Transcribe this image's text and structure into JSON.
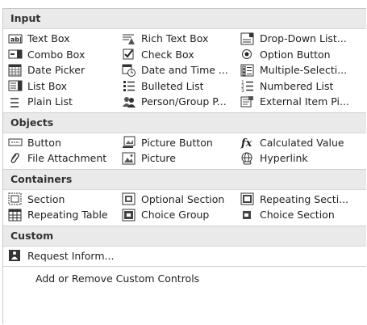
{
  "sections": {
    "input": {
      "title": "Input",
      "items": [
        {
          "label": "Text Box",
          "icon": "text-box-icon"
        },
        {
          "label": "Rich Text Box",
          "icon": "rich-text-box-icon"
        },
        {
          "label": "Drop-Down List...",
          "icon": "drop-down-list-icon"
        },
        {
          "label": "Combo Box",
          "icon": "combo-box-icon"
        },
        {
          "label": "Check Box",
          "icon": "check-box-icon"
        },
        {
          "label": "Option Button",
          "icon": "option-button-icon"
        },
        {
          "label": "Date Picker",
          "icon": "date-picker-icon"
        },
        {
          "label": "Date and Time ...",
          "icon": "date-time-picker-icon"
        },
        {
          "label": "Multiple-Selecti...",
          "icon": "multiple-selection-list-icon"
        },
        {
          "label": "List Box",
          "icon": "list-box-icon"
        },
        {
          "label": "Bulleted List",
          "icon": "bulleted-list-icon"
        },
        {
          "label": "Numbered List",
          "icon": "numbered-list-icon"
        },
        {
          "label": "Plain List",
          "icon": "plain-list-icon"
        },
        {
          "label": "Person/Group P...",
          "icon": "person-group-picker-icon"
        },
        {
          "label": "External Item Pi...",
          "icon": "external-item-picker-icon"
        }
      ]
    },
    "objects": {
      "title": "Objects",
      "items": [
        {
          "label": "Button",
          "icon": "button-icon"
        },
        {
          "label": "Picture Button",
          "icon": "picture-button-icon"
        },
        {
          "label": "Calculated Value",
          "icon": "calculated-value-icon"
        },
        {
          "label": "File Attachment",
          "icon": "file-attachment-icon"
        },
        {
          "label": "Picture",
          "icon": "picture-icon"
        },
        {
          "label": "Hyperlink",
          "icon": "hyperlink-icon"
        }
      ]
    },
    "containers": {
      "title": "Containers",
      "items": [
        {
          "label": "Section",
          "icon": "section-icon"
        },
        {
          "label": "Optional Section",
          "icon": "optional-section-icon"
        },
        {
          "label": "Repeating Secti...",
          "icon": "repeating-section-icon"
        },
        {
          "label": "Repeating Table",
          "icon": "repeating-table-icon"
        },
        {
          "label": "Choice Group",
          "icon": "choice-group-icon"
        },
        {
          "label": "Choice Section",
          "icon": "choice-section-icon"
        }
      ]
    },
    "custom": {
      "title": "Custom",
      "items": [
        {
          "label": "Request Inform...",
          "icon": "request-information-icon"
        }
      ]
    }
  },
  "footer": {
    "label": "Add or Remove Custom Controls"
  }
}
